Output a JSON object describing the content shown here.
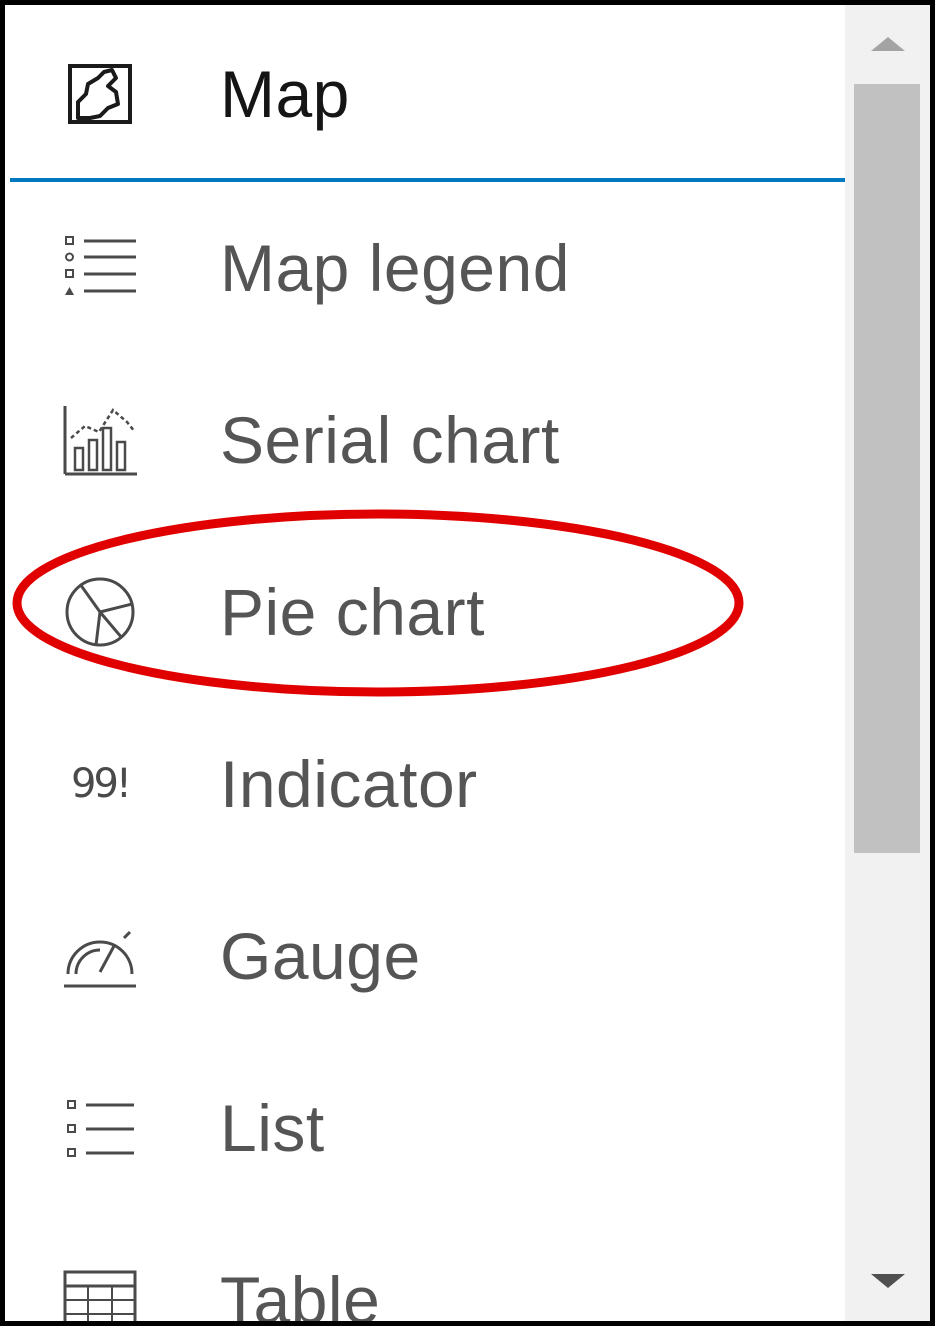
{
  "menu": {
    "items": [
      {
        "label": "Map",
        "icon": "map-icon",
        "selected": true
      },
      {
        "label": "Map legend",
        "icon": "legend-icon"
      },
      {
        "label": "Serial chart",
        "icon": "serial-chart-icon"
      },
      {
        "label": "Pie chart",
        "icon": "pie-chart-icon"
      },
      {
        "label": "Indicator",
        "icon": "indicator-icon",
        "icon_text": "99!"
      },
      {
        "label": "Gauge",
        "icon": "gauge-icon"
      },
      {
        "label": "List",
        "icon": "list-icon"
      },
      {
        "label": "Table",
        "icon": "table-icon"
      }
    ]
  },
  "annotation": {
    "highlighted_item": "Pie chart",
    "color": "#e00000"
  },
  "colors": {
    "selection_border": "#0079c1",
    "scroll_thumb": "#c1c1c1",
    "scroll_track": "#f1f1f1"
  }
}
